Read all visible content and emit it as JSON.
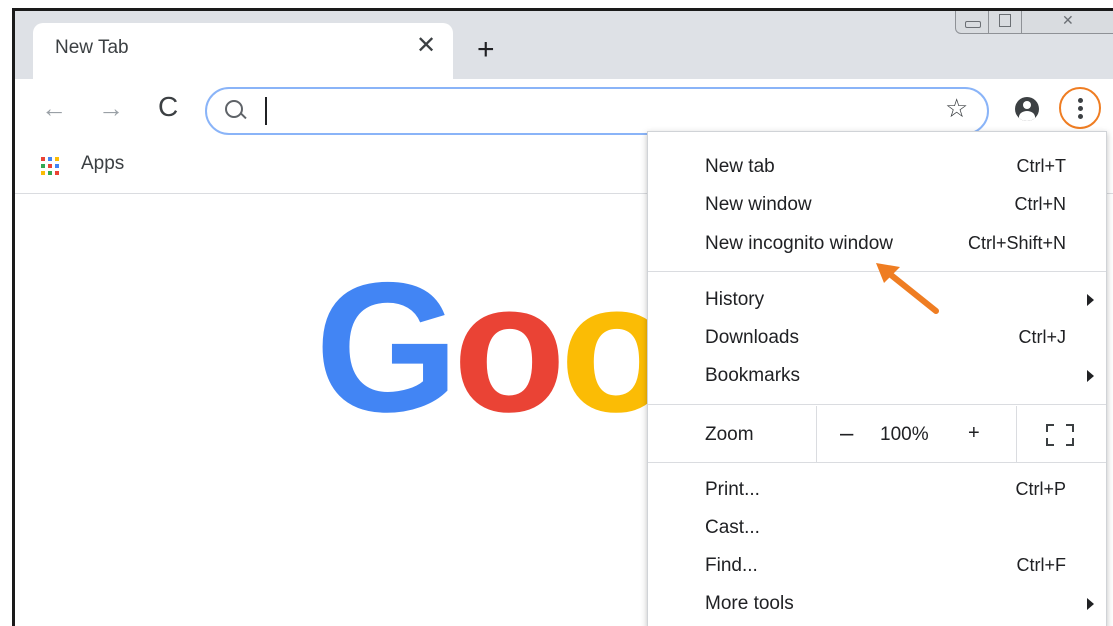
{
  "tab": {
    "title": "New Tab",
    "close_glyph": "✕",
    "new_tab_glyph": "+"
  },
  "window_controls": [
    "minimize-icon",
    "maximize-icon",
    "close-icon"
  ],
  "toolbar": {
    "back_glyph": "←",
    "forward_glyph": "→",
    "reload_glyph": "C",
    "omnibox_value": "",
    "star_glyph": "☆",
    "icons": [
      "back-arrow-icon",
      "forward-arrow-icon",
      "reload-icon",
      "search-icon",
      "star-icon",
      "account-icon",
      "menu-dots-icon"
    ]
  },
  "bookmarks": {
    "apps_label": "Apps"
  },
  "content": {
    "logo_text": "Goog"
  },
  "colors": {
    "accent": "#ef7d22",
    "omnibox_border": "#8ab4f8",
    "google_blue": "#4285f4",
    "google_red": "#ea4335",
    "google_yellow": "#fbbc05"
  },
  "menu": {
    "group1": [
      {
        "label": "New tab",
        "shortcut": "Ctrl+T"
      },
      {
        "label": "New window",
        "shortcut": "Ctrl+N"
      },
      {
        "label": "New incognito window",
        "shortcut": "Ctrl+Shift+N"
      }
    ],
    "group2": [
      {
        "label": "History",
        "shortcut": ""
      },
      {
        "label": "Downloads",
        "shortcut": "Ctrl+J"
      },
      {
        "label": "Bookmarks",
        "shortcut": ""
      }
    ],
    "zoom": {
      "label": "Zoom",
      "minus": "–",
      "value": "100%",
      "plus": "+"
    },
    "group3": [
      {
        "label": "Print...",
        "shortcut": "Ctrl+P"
      },
      {
        "label": "Cast...",
        "shortcut": ""
      },
      {
        "label": "Find...",
        "shortcut": "Ctrl+F"
      },
      {
        "label": "More tools",
        "shortcut": ""
      }
    ]
  }
}
